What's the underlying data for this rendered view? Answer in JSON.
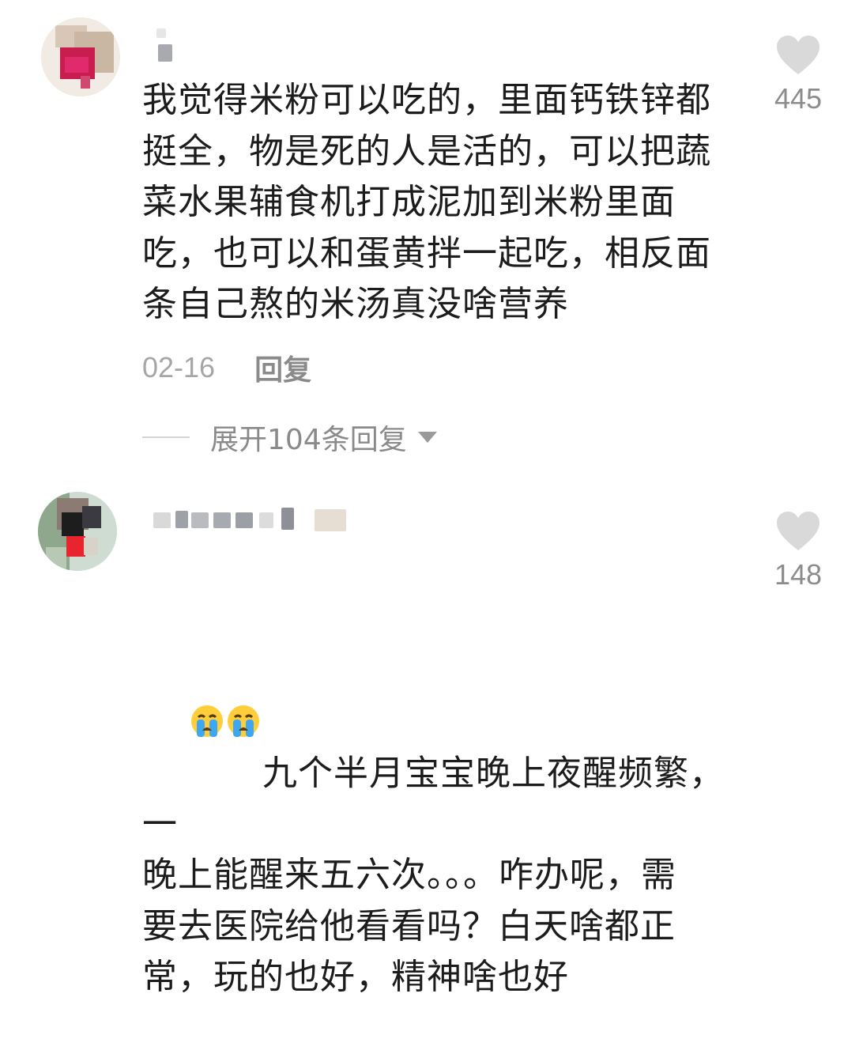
{
  "comments": [
    {
      "text": "我觉得米粉可以吃的，里面钙铁锌都\n挺全，物是死的人是活的，可以把蔬\n菜水果辅食机打成泥加到米粉里面\n吃，也可以和蛋黄拌一起吃，相反面\n条自己熬的米汤真没啥营养",
      "likes": "445",
      "date": "02-16",
      "reply_label": "回复",
      "expand_label": "展开104条回复"
    },
    {
      "text": "九个半月宝宝晚上夜醒频繁，一\n晚上能醒来五六次。。。咋办呢，需\n要去医院给他看看吗？白天啥都正\n常，玩的也好，精神啥也好",
      "likes": "148",
      "emoji": [
        "crying-face-icon",
        "crying-face-icon"
      ]
    }
  ],
  "colors": {
    "text": "#1c1c1c",
    "meta": "#a6a6a6",
    "like_icon": "#d9d9d9",
    "avatar1": "#c81e4f"
  }
}
